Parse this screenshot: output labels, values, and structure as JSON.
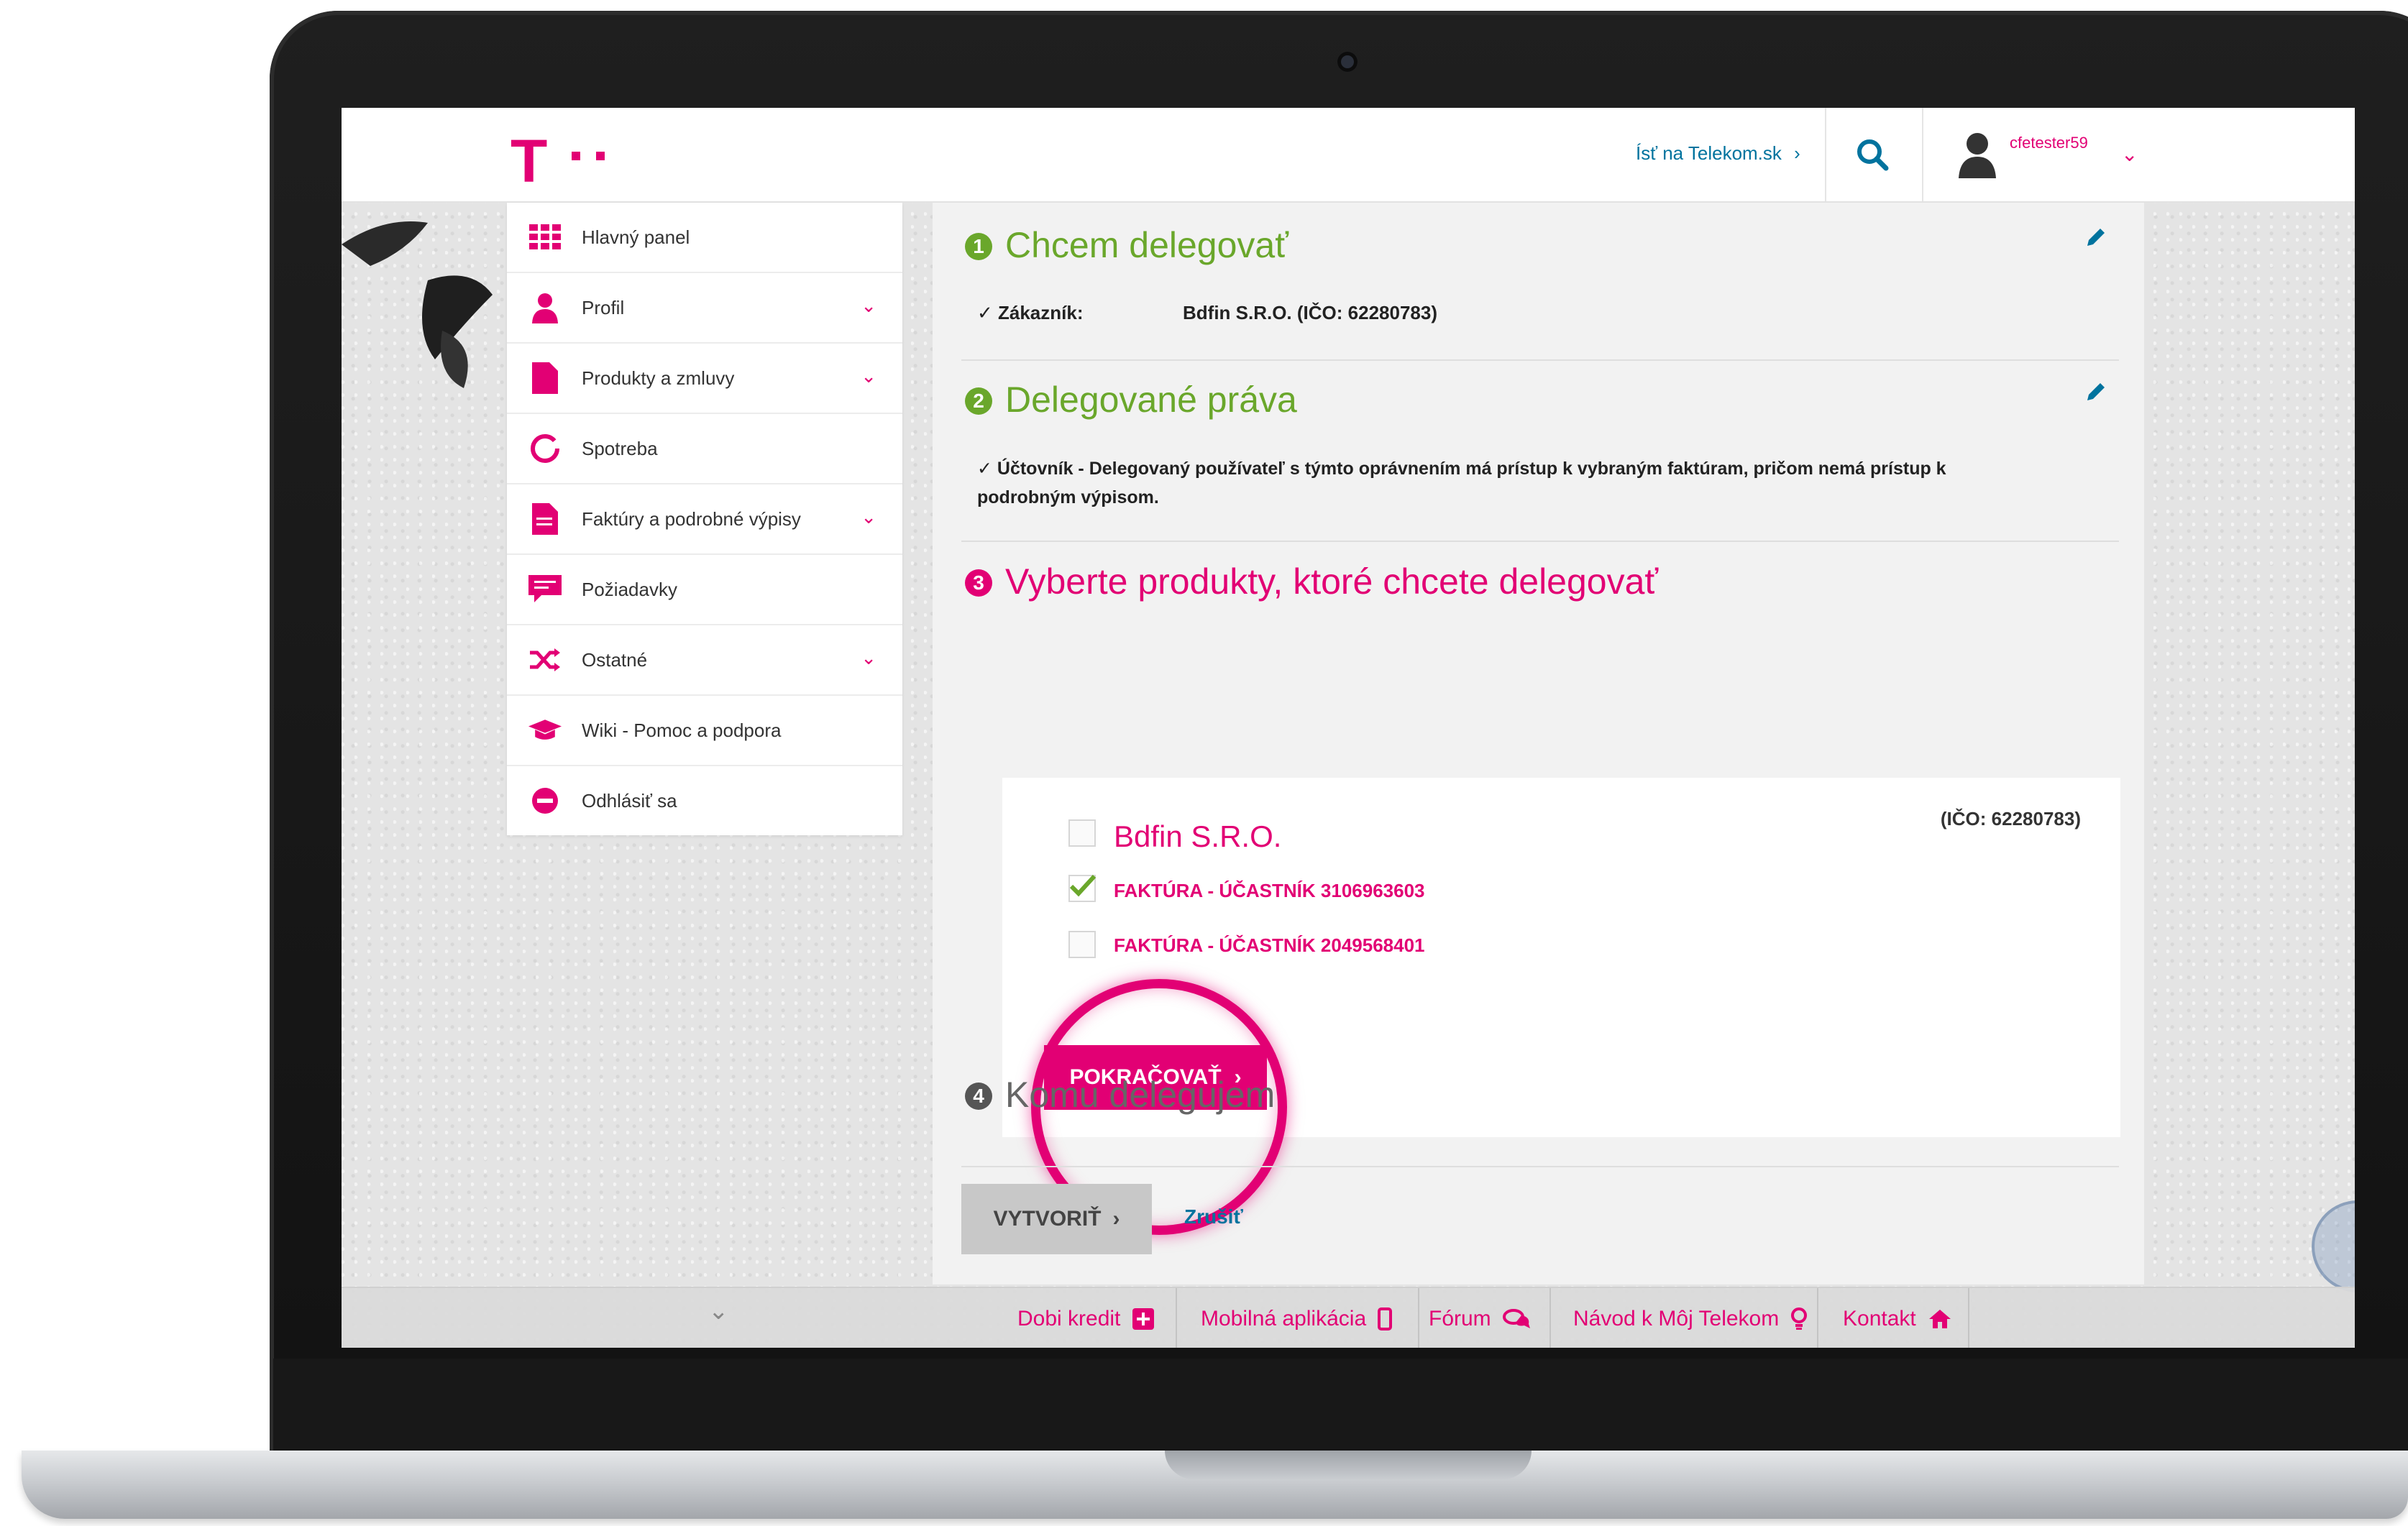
{
  "header": {
    "logo": "T",
    "external_link": "Ísť na Telekom.sk",
    "username": "cfetester59"
  },
  "sidebar": {
    "items": [
      {
        "label": "Hlavný panel",
        "icon": "grid-icon",
        "has_chevron": false
      },
      {
        "label": "Profil",
        "icon": "user-icon",
        "has_chevron": true
      },
      {
        "label": "Produkty a zmluvy",
        "icon": "document-icon",
        "has_chevron": true
      },
      {
        "label": "Spotreba",
        "icon": "ring-icon",
        "has_chevron": false
      },
      {
        "label": "Faktúry a podrobné výpisy",
        "icon": "invoice-icon",
        "has_chevron": true
      },
      {
        "label": "Požiadavky",
        "icon": "chat-request-icon",
        "has_chevron": false
      },
      {
        "label": "Ostatné",
        "icon": "shuffle-icon",
        "has_chevron": true
      },
      {
        "label": "Wiki - Pomoc a podpora",
        "icon": "graduation-cap-icon",
        "has_chevron": false
      },
      {
        "label": "Odhlásiť sa",
        "icon": "logout-icon",
        "has_chevron": false
      }
    ]
  },
  "steps": {
    "step1": {
      "number": "1",
      "title": "Chcem delegovať",
      "customer_label": "✓ Zákazník:",
      "customer_value": "Bdfin S.R.O. (IČO: 62280783)"
    },
    "step2": {
      "number": "2",
      "title": "Delegované práva",
      "description": "✓ Účtovník - Delegovaný používateľ s týmto oprávnením má prístup k vybraným faktúram, pričom nemá prístup k podrobným výpisom."
    },
    "step3": {
      "number": "3",
      "title": "Vyberte produkty, ktoré chcete delegovať",
      "company": "Bdfin S.R.O.",
      "ico": "(IČO: 62280783)",
      "items": [
        {
          "label": "FAKTÚRA - ÚČASTNÍK 3106963603",
          "checked": true
        },
        {
          "label": "FAKTÚRA - ÚČASTNÍK 2049568401",
          "checked": false
        }
      ],
      "continue_label": "POKRAČOVAŤ"
    },
    "step4": {
      "number": "4",
      "title": "Komu delegujem"
    }
  },
  "actions": {
    "create_label": "VYTVORIŤ",
    "cancel_label": "Zrušiť"
  },
  "footer": {
    "items": [
      {
        "label": "Dobi kredit",
        "icon": "plus-square-icon"
      },
      {
        "label": "Mobilná aplikácia",
        "icon": "phone-icon"
      },
      {
        "label": "Fórum",
        "icon": "comments-icon"
      },
      {
        "label": "Návod k Môj Telekom",
        "icon": "lightbulb-icon"
      },
      {
        "label": "Kontakt",
        "icon": "home-icon"
      }
    ]
  },
  "colors": {
    "brand": "#e20074",
    "step_done": "#6aa72b",
    "link": "#00739e"
  }
}
